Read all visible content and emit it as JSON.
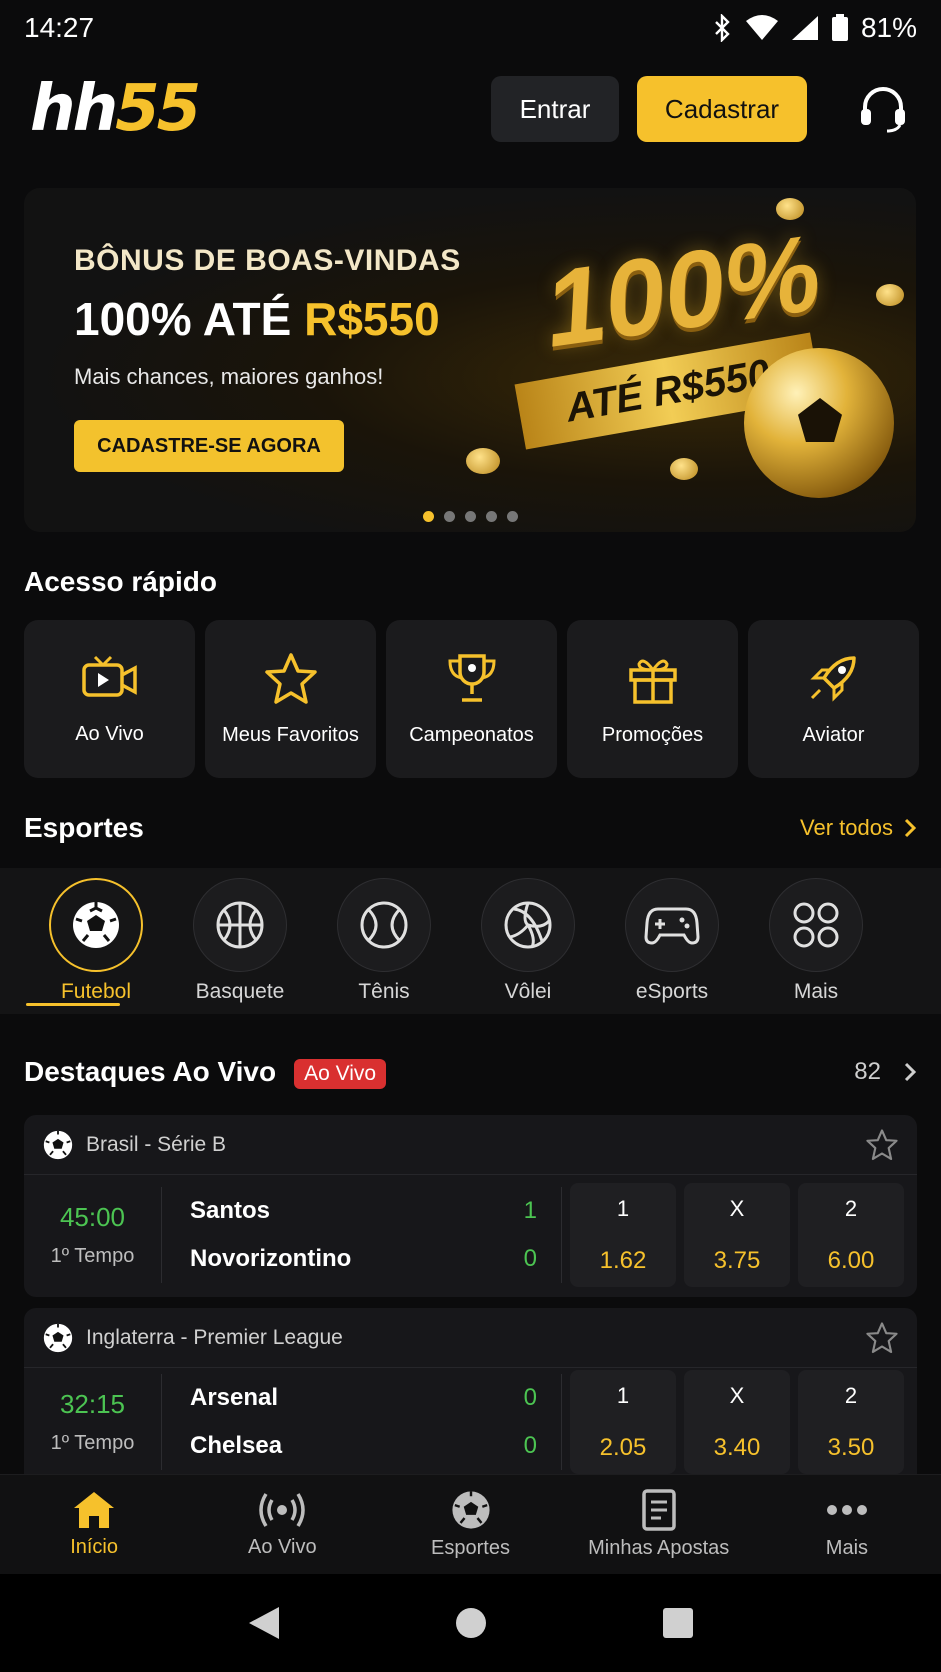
{
  "status": {
    "time": "14:27",
    "battery": "81%"
  },
  "header": {
    "logo_part1": "hh",
    "logo_part2": "55",
    "login_label": "Entrar",
    "register_label": "Cadastrar"
  },
  "banner": {
    "title": "BÔNUS DE BOAS-VINDAS",
    "headline_white": "100% ATÉ ",
    "headline_gold": "R$550",
    "subtitle": "Mais chances, maiores ganhos!",
    "cta": "CADASTRE-SE AGORA",
    "art_big": "100%",
    "art_ribbon": "ATÉ R$550",
    "pages": 5,
    "active_page": 1
  },
  "quick_access": {
    "title": "Acesso rápido",
    "items": [
      {
        "label": "Ao Vivo",
        "icon": "live-tv-icon"
      },
      {
        "label": "Meus Favoritos",
        "icon": "star-icon"
      },
      {
        "label": "Campeonatos",
        "icon": "trophy-icon"
      },
      {
        "label": "Promoções",
        "icon": "gift-icon"
      },
      {
        "label": "Aviator",
        "icon": "rocket-icon"
      }
    ]
  },
  "sports": {
    "title": "Esportes",
    "see_all": "Ver todos",
    "items": [
      {
        "label": "Futebol",
        "icon": "soccer-ball-icon",
        "active": true
      },
      {
        "label": "Basquete",
        "icon": "basketball-icon"
      },
      {
        "label": "Tênis",
        "icon": "tennis-ball-icon"
      },
      {
        "label": "Vôlei",
        "icon": "volleyball-icon"
      },
      {
        "label": "eSports",
        "icon": "gamepad-icon"
      },
      {
        "label": "Mais",
        "icon": "grid-icon"
      }
    ]
  },
  "live": {
    "title": "Destaques Ao Vivo",
    "badge": "Ao Vivo",
    "count": "82",
    "matches": [
      {
        "league": "Brasil - Série B",
        "clock": "45:00",
        "period": "1º Tempo",
        "home": "Santos",
        "home_score": "1",
        "away": "Novorizontino",
        "away_score": "0",
        "odds": [
          {
            "label": "1",
            "value": "1.62"
          },
          {
            "label": "X",
            "value": "3.75"
          },
          {
            "label": "2",
            "value": "6.00"
          }
        ]
      },
      {
        "league": "Inglaterra - Premier League",
        "clock": "32:15",
        "period": "1º Tempo",
        "home": "Arsenal",
        "home_score": "0",
        "away": "Chelsea",
        "away_score": "0",
        "odds": [
          {
            "label": "1",
            "value": "2.05"
          },
          {
            "label": "X",
            "value": "3.40"
          },
          {
            "label": "2",
            "value": "3.50"
          }
        ]
      }
    ]
  },
  "bottom_nav": [
    {
      "label": "Início",
      "icon": "home-icon",
      "active": true
    },
    {
      "label": "Ao Vivo",
      "icon": "broadcast-icon"
    },
    {
      "label": "Esportes",
      "icon": "soccer-ball-icon"
    },
    {
      "label": "Minhas Apostas",
      "icon": "betslip-icon"
    },
    {
      "label": "Mais",
      "icon": "more-dots-icon"
    }
  ],
  "colors": {
    "accent": "#f6c12c",
    "live_red": "#d93030",
    "score_green": "#4cc452",
    "background": "#0b0b0c"
  }
}
